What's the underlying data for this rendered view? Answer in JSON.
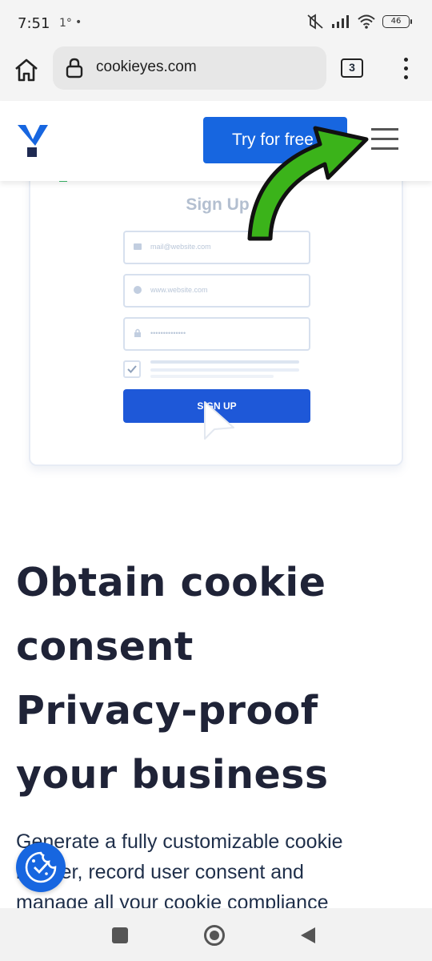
{
  "status_bar": {
    "time": "7:51",
    "temp": "1°",
    "dot": "•",
    "battery": "46"
  },
  "browser": {
    "url": "cookieyes.com",
    "tab_count": "3"
  },
  "header": {
    "cta_label": "Try for free"
  },
  "signup_card": {
    "title": "Sign Up",
    "email_placeholder": "mail@website.com",
    "website_placeholder": "www.website.com",
    "password_placeholder": "••••••••••••••",
    "button_label": "SIGN UP"
  },
  "hero": {
    "heading_line1": "Obtain cookie",
    "heading_line2": "consent",
    "heading_line3": "Privacy-proof",
    "heading_line4": "your business",
    "text_line1": "Generate a fully customizable cookie",
    "text_line2": "banner, record user consent and",
    "text_line3": "manage all your cookie compliance"
  },
  "colors": {
    "accent": "#1766e0",
    "arrow": "#3bb31a",
    "heading": "#1f2337"
  },
  "icons": [
    "home-icon",
    "lock-icon",
    "overflow-menu-icon",
    "hamburger-icon",
    "cookie-consent-icon",
    "arrow-annotation-icon"
  ]
}
